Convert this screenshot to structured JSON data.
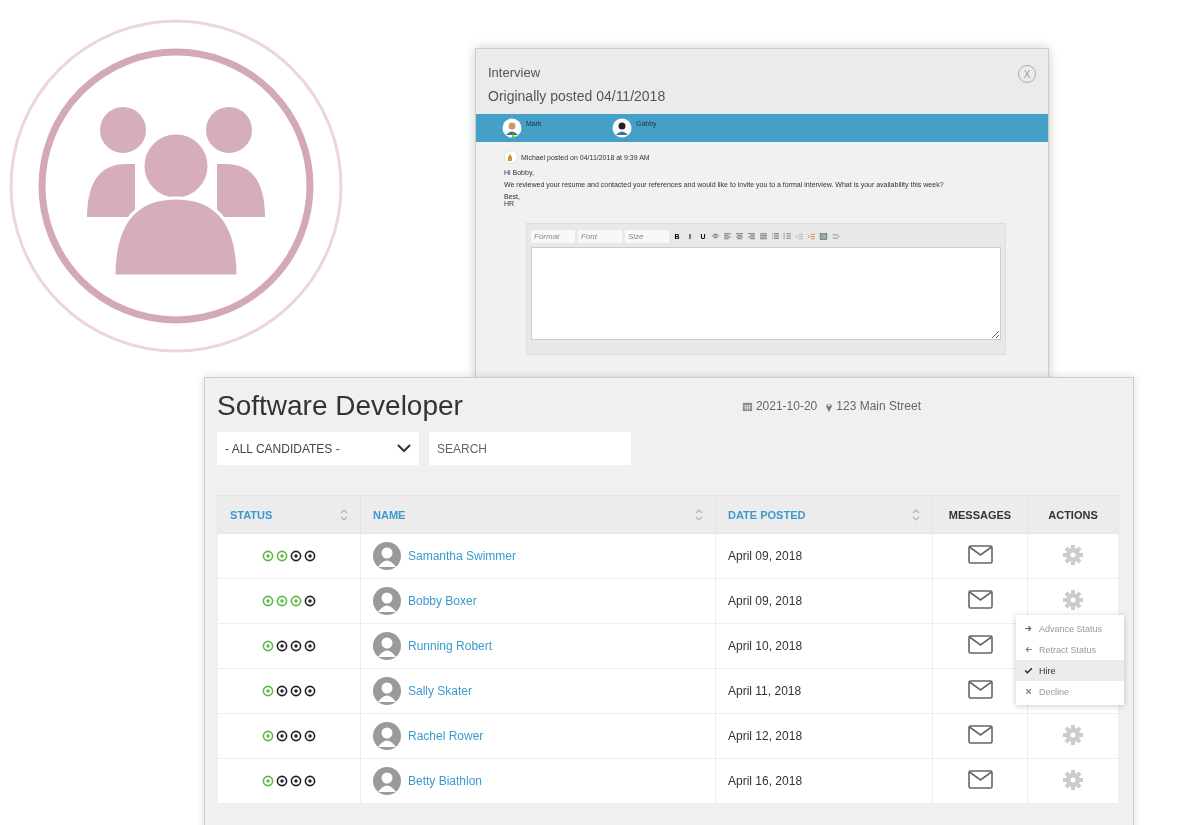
{
  "dialog": {
    "title": "Interview",
    "subtitle": "Originally posted 04/11/2018",
    "close": "X",
    "participants": [
      {
        "name": "Mark",
        "online": true
      },
      {
        "name": "Gabby",
        "online": false
      }
    ],
    "message": {
      "author": "Michael",
      "meta": "posted on 04/11/2018 at 9:39 AM",
      "greeting": "Hi Bobby,",
      "body": "We reviewed your resume and contacted your references and would like to invite you to a formal interview. What is your availability this week?",
      "signoff": "Best,",
      "signature": "HR"
    },
    "editor": {
      "dropdowns": [
        "Format",
        "Font",
        "Size"
      ],
      "buttons": [
        {
          "kind": "text",
          "label": "B"
        },
        {
          "kind": "text",
          "label": "I"
        },
        {
          "kind": "text",
          "label": "U"
        },
        {
          "kind": "icon"
        },
        {
          "kind": "icon"
        },
        {
          "kind": "icon"
        },
        {
          "kind": "icon"
        },
        {
          "kind": "icon"
        },
        {
          "kind": "icon"
        },
        {
          "kind": "icon"
        },
        {
          "kind": "icon"
        },
        {
          "kind": "icon"
        },
        {
          "kind": "icon"
        },
        {
          "kind": "icon"
        }
      ]
    }
  },
  "job": {
    "title": "Software Developer",
    "date": "2021-10-20",
    "location": "123 Main Street",
    "filter": "- ALL CANDIDATES -",
    "search_placeholder": "SEARCH"
  },
  "table": {
    "columns": [
      {
        "label": "STATUS",
        "sortable": true
      },
      {
        "label": "NAME",
        "sortable": true
      },
      {
        "label": "DATE POSTED",
        "sortable": true
      },
      {
        "label": "MESSAGES",
        "sortable": false
      },
      {
        "label": "ACTIONS",
        "sortable": false
      }
    ],
    "rows": [
      {
        "steps": [
          {
            "done": true
          },
          {
            "done": true
          },
          {
            "done": false
          },
          {
            "done": false
          }
        ],
        "name": "Samantha Swimmer",
        "date": "April 09, 2018"
      },
      {
        "steps": [
          {
            "done": true
          },
          {
            "done": true
          },
          {
            "done": true
          },
          {
            "done": false
          }
        ],
        "name": "Bobby Boxer",
        "date": "April 09, 2018",
        "menu": [
          {
            "label": "Advance Status",
            "selected": false
          },
          {
            "label": "Retract Status",
            "selected": false
          },
          {
            "label": "Hire",
            "selected": true
          },
          {
            "label": "Decline",
            "selected": false
          }
        ]
      },
      {
        "steps": [
          {
            "done": true
          },
          {
            "done": false
          },
          {
            "done": false
          },
          {
            "done": false
          }
        ],
        "name": "Running Robert",
        "date": "April 10, 2018"
      },
      {
        "steps": [
          {
            "done": true
          },
          {
            "done": false
          },
          {
            "done": false
          },
          {
            "done": false
          }
        ],
        "name": "Sally Skater",
        "date": "April 11, 2018"
      },
      {
        "steps": [
          {
            "done": true
          },
          {
            "done": false
          },
          {
            "done": false
          },
          {
            "done": false
          }
        ],
        "name": "Rachel Rower",
        "date": "April 12, 2018"
      },
      {
        "steps": [
          {
            "done": true
          },
          {
            "done": false
          },
          {
            "done": false
          },
          {
            "done": false
          }
        ],
        "name": "Betty Biathlon",
        "date": "April 16, 2018"
      }
    ]
  }
}
